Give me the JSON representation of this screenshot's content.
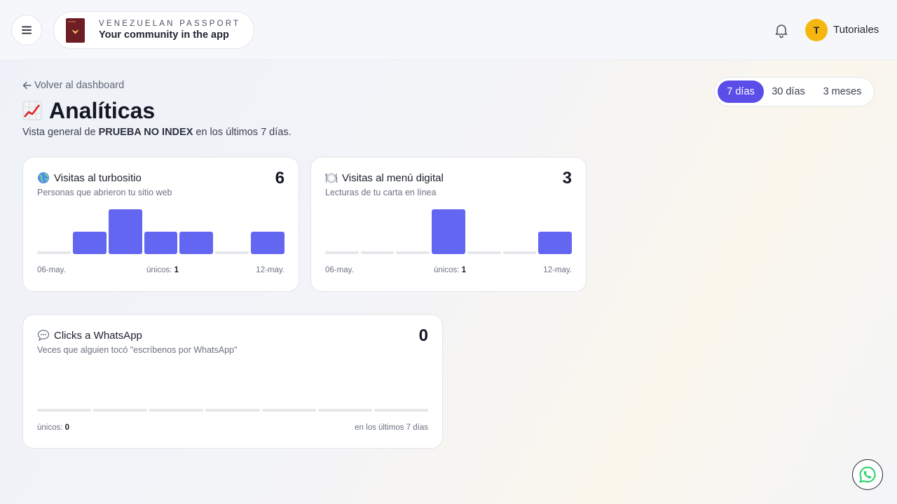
{
  "header": {
    "brand_top": "VENEZUELAN PASSPORT",
    "brand_sub": "Your community in the app",
    "passport_label": "VENEZ",
    "avatar_initial": "T",
    "user_name": "Tutoriales"
  },
  "page": {
    "back_label": "Volver al dashboard",
    "title": "Analíticas",
    "subtitle_prefix": "Vista general de ",
    "subtitle_site": "PRUEBA NO INDEX",
    "subtitle_suffix": " en los últimos 7 días."
  },
  "range": {
    "options": [
      "7 días",
      "30 días",
      "3 meses"
    ],
    "selected": "7 días"
  },
  "cards": [
    {
      "icon": "globe-icon",
      "title": "Visitas al turbositio",
      "description": "Personas que abrieron tu sitio web",
      "count": "6",
      "daily": [
        0,
        1,
        2,
        1,
        1,
        0,
        1
      ],
      "start_date": "06-may.",
      "end_date": "12-may.",
      "uniques_label": "únicos:",
      "uniques": "1"
    },
    {
      "icon": "plate-icon",
      "title": "Visitas al menú digital",
      "description": "Lecturas de tu carta en línea",
      "count": "3",
      "daily": [
        0,
        0,
        0,
        2,
        0,
        0,
        1
      ],
      "start_date": "06-may.",
      "end_date": "12-may.",
      "uniques_label": "únicos:",
      "uniques": "1"
    },
    {
      "icon": "speech-bubble-icon",
      "title": "Clicks a WhatsApp",
      "description": "Veces que alguien tocó \"escríbenos por WhatsApp\"",
      "count": "0",
      "daily": [
        0,
        0,
        0,
        0,
        0,
        0,
        0
      ],
      "uniques_label": "únicos:",
      "uniques": "0",
      "period_label": "en los últimos 7 días"
    }
  ],
  "colors": {
    "accent": "#5b4ee8",
    "bar": "#6366f1",
    "bar_empty": "#e5e7eb",
    "avatar": "#f5b70f",
    "whatsapp": "#25d366"
  }
}
